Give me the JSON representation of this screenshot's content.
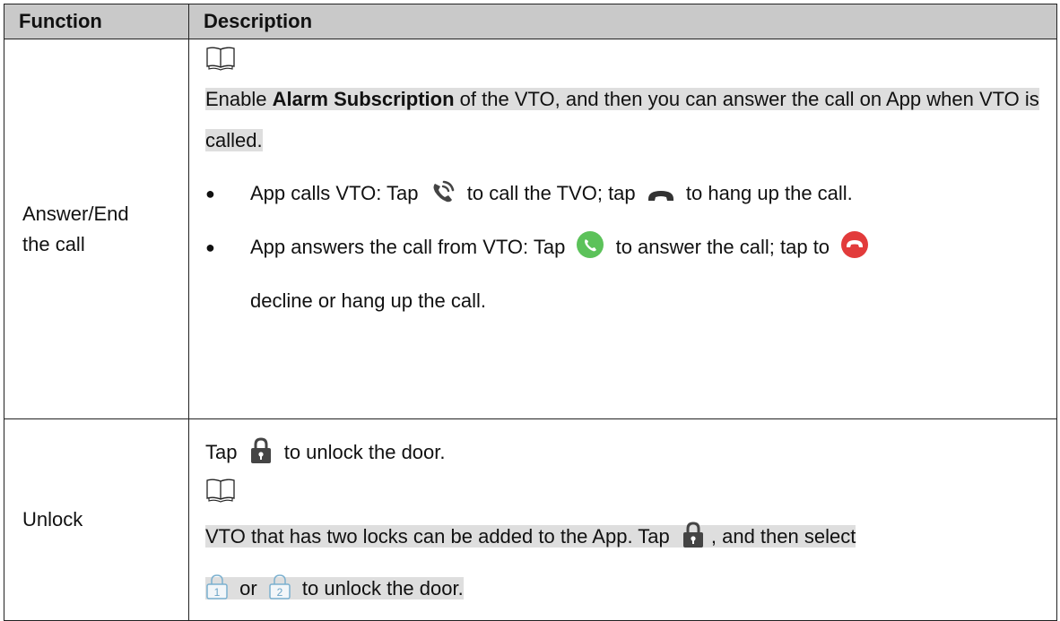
{
  "table": {
    "header": {
      "function": "Function",
      "description": "Description"
    },
    "rows": [
      {
        "function": "Answer/End the call",
        "note": {
          "icon": "note-book-icon",
          "prefix": "Enable ",
          "bold": "Alarm Subscription",
          "suffix": " of the VTO, and then you can answer the call on App when VTO is called."
        },
        "bullets": [
          {
            "a": "App calls VTO: Tap ",
            "icon1": "call-phone-icon",
            "b": " to call the TVO; tap ",
            "icon2": "hang-up-icon",
            "c": " to hang up the call."
          },
          {
            "a": "App answers the call from VTO: Tap ",
            "icon1": "green-answer-icon",
            "b": " to answer the call; tap to ",
            "icon2": "red-decline-icon",
            "c": " decline or hang up the call."
          }
        ]
      },
      {
        "function": "Unlock",
        "line1_a": "Tap ",
        "line1_icon": "unlock-icon",
        "line1_b": " to unlock the door.",
        "note": {
          "icon": "note-book-icon",
          "a": "VTO that has two locks can be added to the App. Tap ",
          "icon1": "unlock-icon",
          "b": ", and then select",
          "icon2": "lock-1-icon",
          "c": " or ",
          "icon3": "lock-2-icon",
          "d": " to unlock the door."
        }
      }
    ]
  }
}
